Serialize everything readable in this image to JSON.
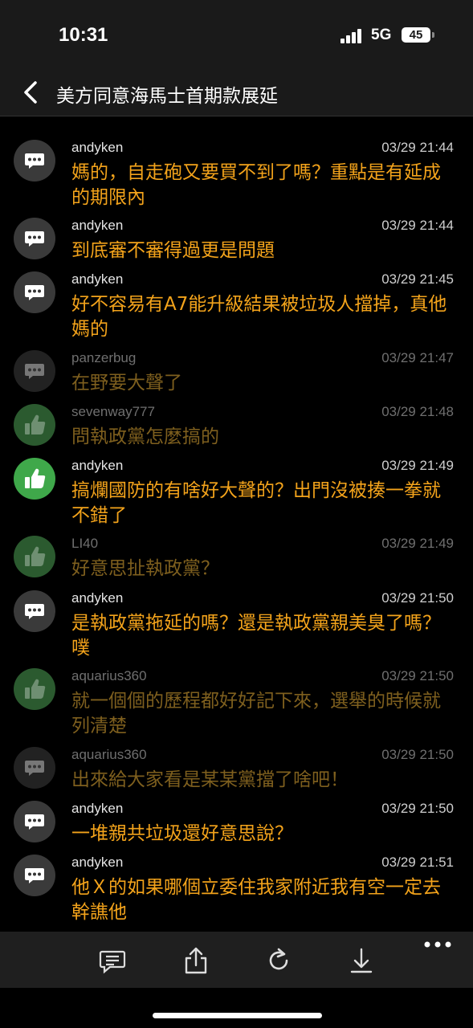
{
  "status": {
    "time": "10:31",
    "network": "5G",
    "battery": "45"
  },
  "header": {
    "title": "美方同意海馬士首期款展延"
  },
  "comments": [
    {
      "user": "andyken",
      "time": "03/29 21:44",
      "text": "媽的，自走砲又要買不到了嗎？重點是有延成的期限內",
      "vote": "arrow",
      "dim": false
    },
    {
      "user": "andyken",
      "time": "03/29 21:44",
      "text": "到底審不審得過更是問題",
      "vote": "arrow",
      "dim": false
    },
    {
      "user": "andyken",
      "time": "03/29 21:45",
      "text": "好不容易有A7能升級結果被垃圾人擋掉，真他媽的",
      "vote": "arrow",
      "dim": false
    },
    {
      "user": "panzerbug",
      "time": "03/29 21:47",
      "text": "在野要大聲了",
      "vote": "arrow",
      "dim": true
    },
    {
      "user": "sevenway777",
      "time": "03/29 21:48",
      "text": "問執政黨怎麼搞的",
      "vote": "push",
      "dim": true
    },
    {
      "user": "andyken",
      "time": "03/29 21:49",
      "text": "搞爛國防的有啥好大聲的？出門沒被揍一拳就不錯了",
      "vote": "push",
      "dim": false
    },
    {
      "user": "LI40",
      "time": "03/29 21:49",
      "text": "好意思扯執政黨？",
      "vote": "push",
      "dim": true
    },
    {
      "user": "andyken",
      "time": "03/29 21:50",
      "text": "是執政黨拖延的嗎？還是執政黨親美臭了嗎？噗",
      "vote": "arrow",
      "dim": false
    },
    {
      "user": "aquarius360",
      "time": "03/29 21:50",
      "text": "就一個個的歷程都好好記下來，選舉的時候就列清楚",
      "vote": "push",
      "dim": true
    },
    {
      "user": "aquarius360",
      "time": "03/29 21:50",
      "text": "出來給大家看是某某黨擋了啥吧！",
      "vote": "arrow",
      "dim": true
    },
    {
      "user": "andyken",
      "time": "03/29 21:50",
      "text": "一堆親共垃圾還好意思說？",
      "vote": "arrow",
      "dim": false
    },
    {
      "user": "andyken",
      "time": "03/29 21:51",
      "text": "他Ｘ的如果哪個立委住我家附近我有空一定去幹譙他",
      "vote": "arrow",
      "dim": false
    }
  ],
  "toolbar": {
    "items": [
      {
        "name": "comment-icon"
      },
      {
        "name": "share-icon"
      },
      {
        "name": "refresh-icon"
      },
      {
        "name": "download-icon"
      },
      {
        "name": "more-icon"
      }
    ]
  },
  "colors": {
    "comment_text": "#f3a31b",
    "push_bright": "#3fa84a",
    "push_dim": "#2b5a2f",
    "arrow_bright": "#3a3a3a",
    "arrow_dim": "#222222"
  }
}
